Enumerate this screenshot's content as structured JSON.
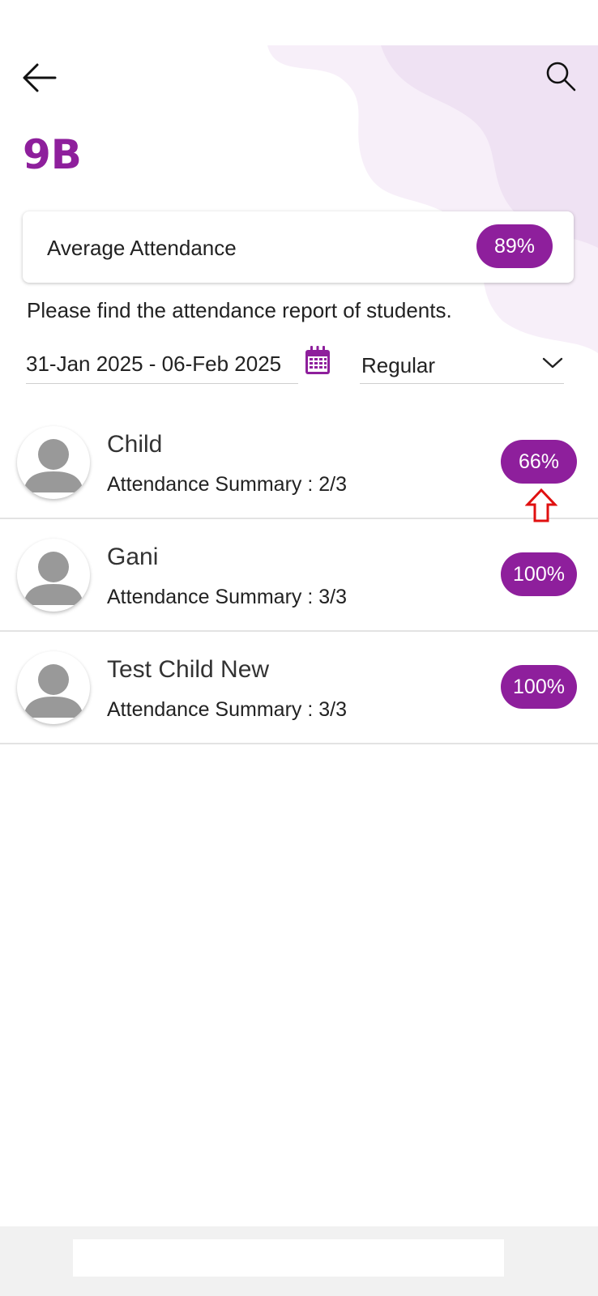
{
  "header": {
    "back_icon": "arrow-left-icon",
    "search_icon": "search-icon",
    "title": "9B"
  },
  "summary": {
    "label": "Average Attendance",
    "value": "89%"
  },
  "intro_text": "Please find the attendance report of students.",
  "filters": {
    "date_range": "31-Jan 2025 - 06-Feb 2025",
    "calendar_icon": "calendar-icon",
    "type": "Regular",
    "type_icon": "chevron-down-icon"
  },
  "students": [
    {
      "name": "Child",
      "summary": "Attendance Summary : 2/3",
      "percent": "66%"
    },
    {
      "name": "Gani",
      "summary": "Attendance Summary : 3/3",
      "percent": "100%"
    },
    {
      "name": "Test Child New",
      "summary": "Attendance Summary : 3/3",
      "percent": "100%"
    }
  ],
  "colors": {
    "accent": "#8e1f9c",
    "blob_light": "#f6eef8",
    "annotation": "#e01010"
  }
}
